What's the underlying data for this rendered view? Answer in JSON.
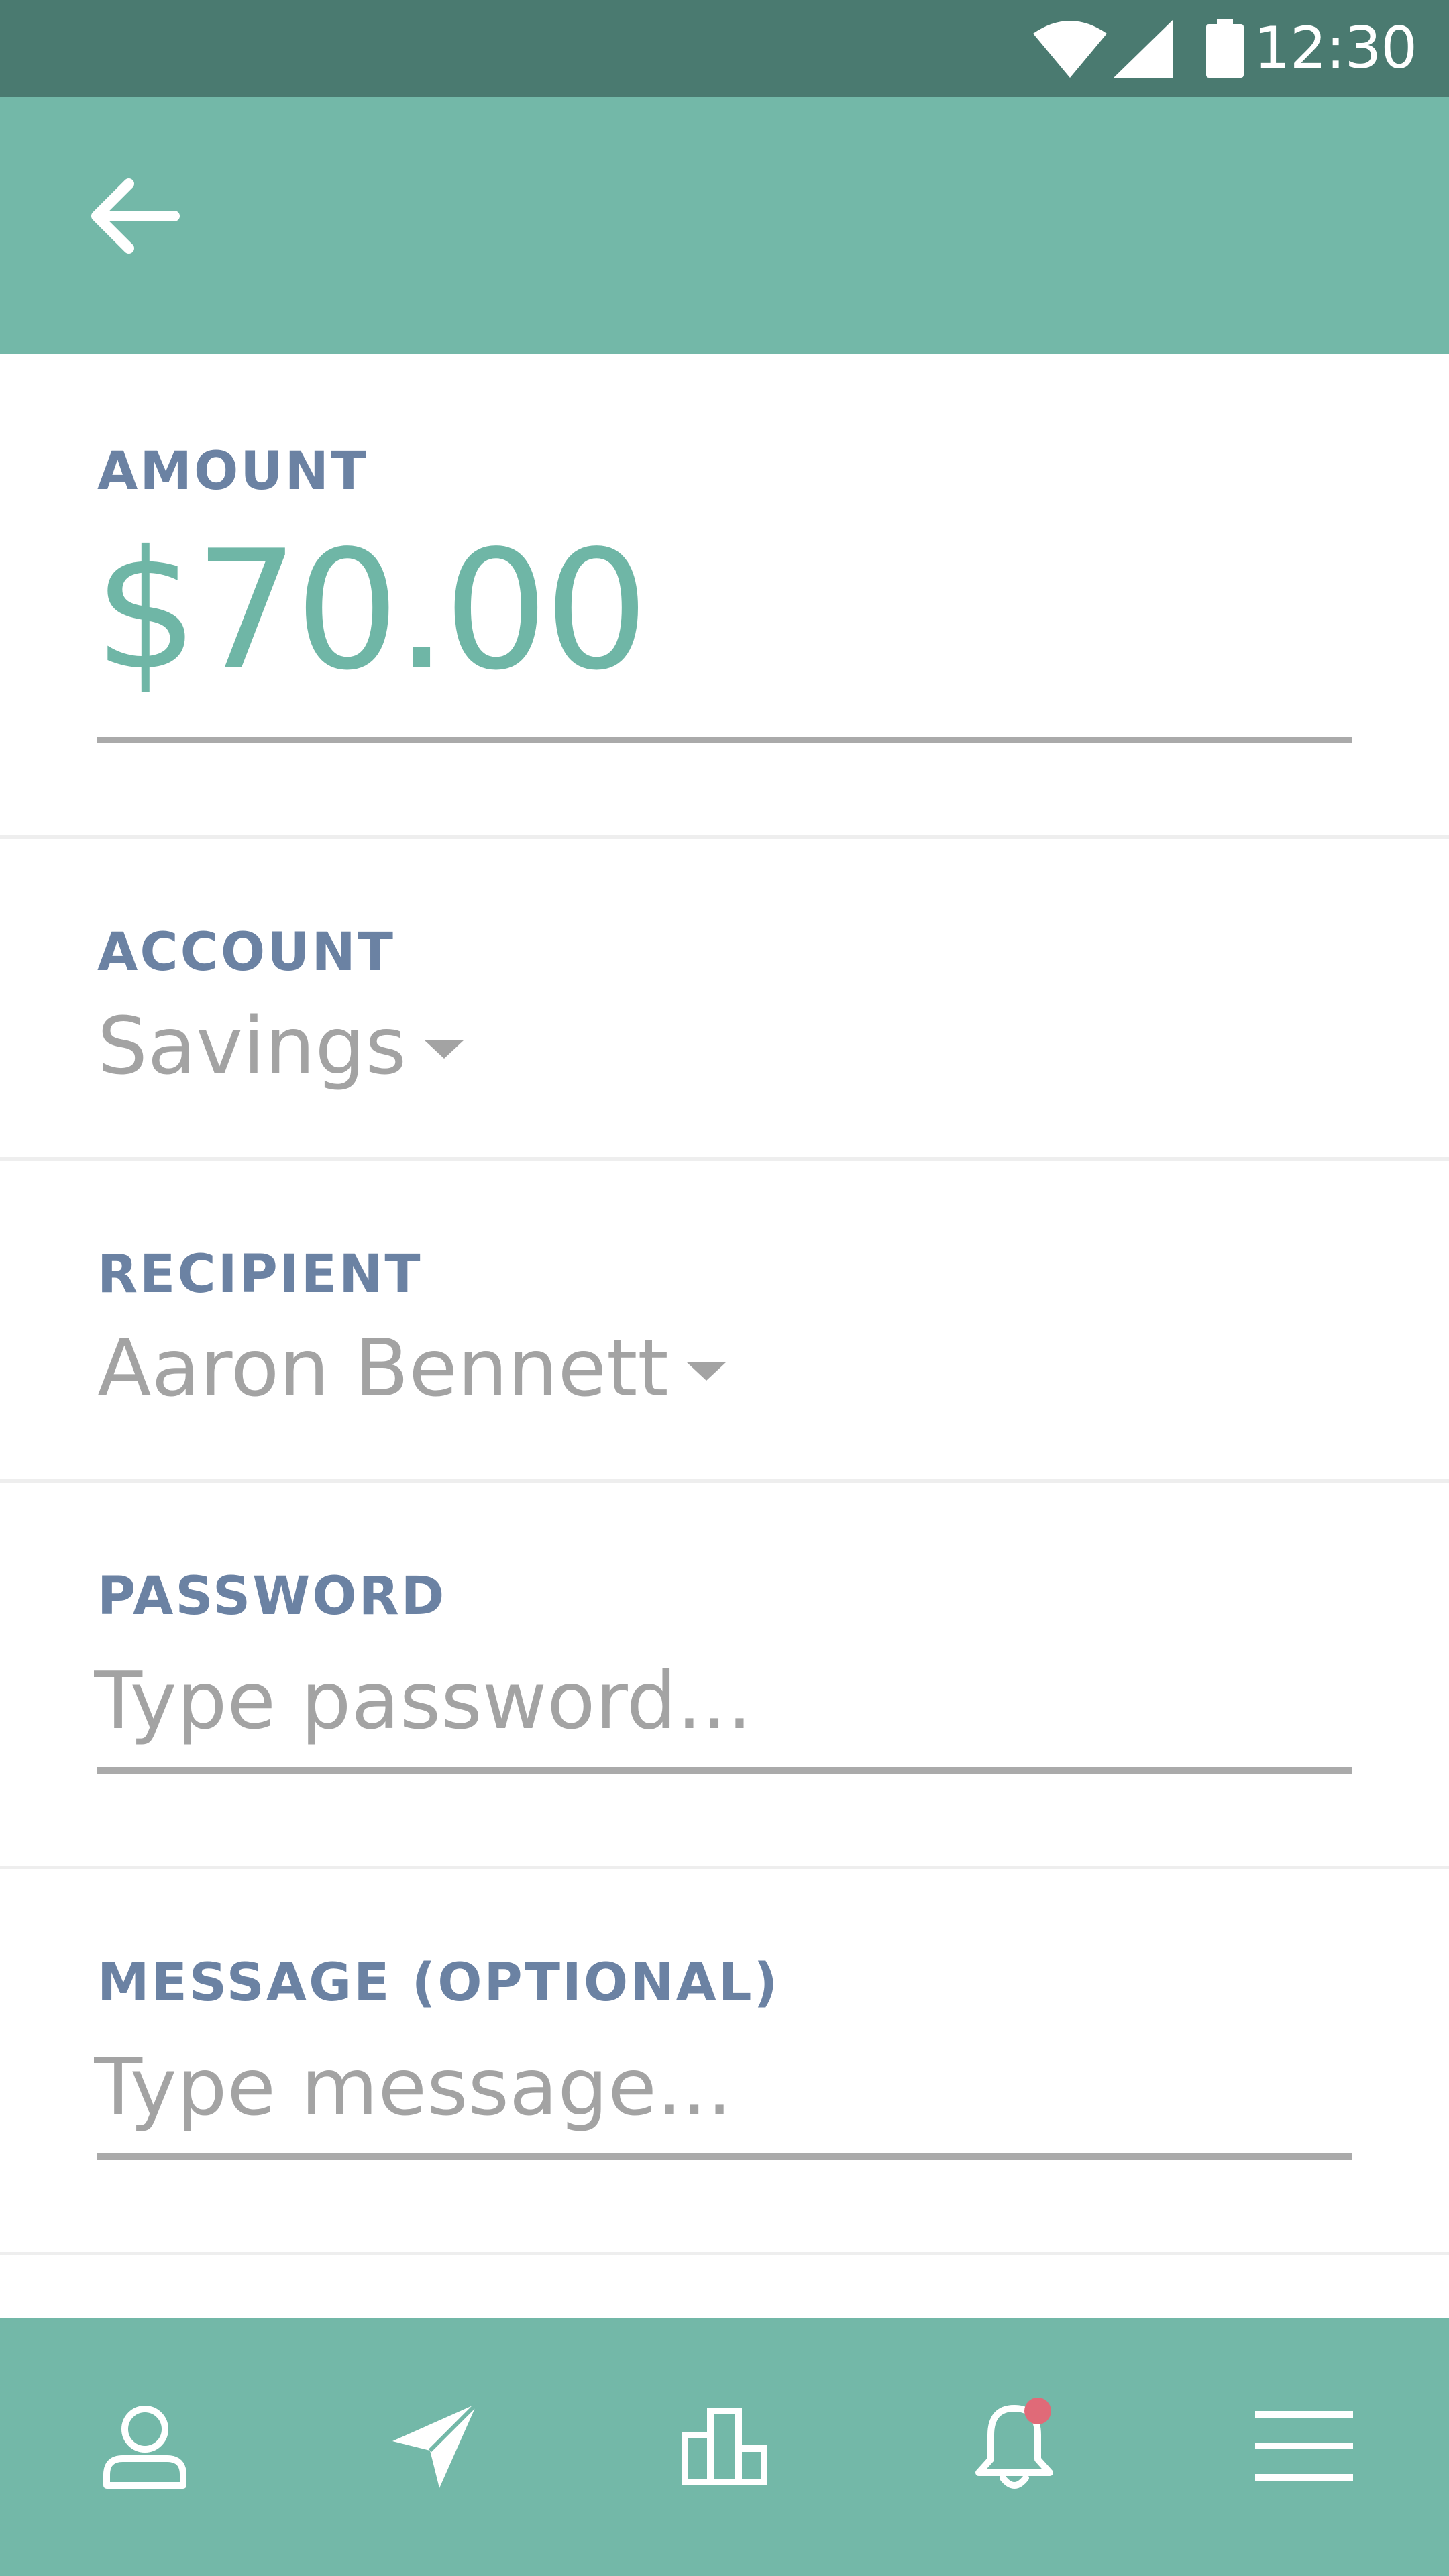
{
  "status_bar": {
    "time": "12:30",
    "icons": [
      "wifi-icon",
      "cellular-signal-icon",
      "battery-icon"
    ],
    "background": "#4a7a70"
  },
  "app_bar": {
    "back_icon": "arrow-left-icon",
    "background": "#73b8a8"
  },
  "form": {
    "amount": {
      "label": "AMOUNT",
      "value": "$70.00"
    },
    "account": {
      "label": "ACCOUNT",
      "value": "Savings"
    },
    "recipient": {
      "label": "RECIPIENT",
      "value": "Aaron Bennett"
    },
    "password": {
      "label": "PASSWORD",
      "placeholder": "Type password..."
    },
    "message": {
      "label": "MESSAGE (OPTIONAL)",
      "placeholder": "Type message..."
    }
  },
  "bottom_nav": {
    "items": [
      {
        "icon": "profile-icon"
      },
      {
        "icon": "send-icon"
      },
      {
        "icon": "bar-chart-icon"
      },
      {
        "icon": "bell-icon",
        "has_notification": true
      },
      {
        "icon": "menu-icon"
      }
    ],
    "notification_color": "#e06a78"
  },
  "colors": {
    "accent": "#73b8a8",
    "amount_text": "#6fb6a6",
    "label_text": "#6b82a3",
    "muted_text": "#a3a3a3"
  }
}
